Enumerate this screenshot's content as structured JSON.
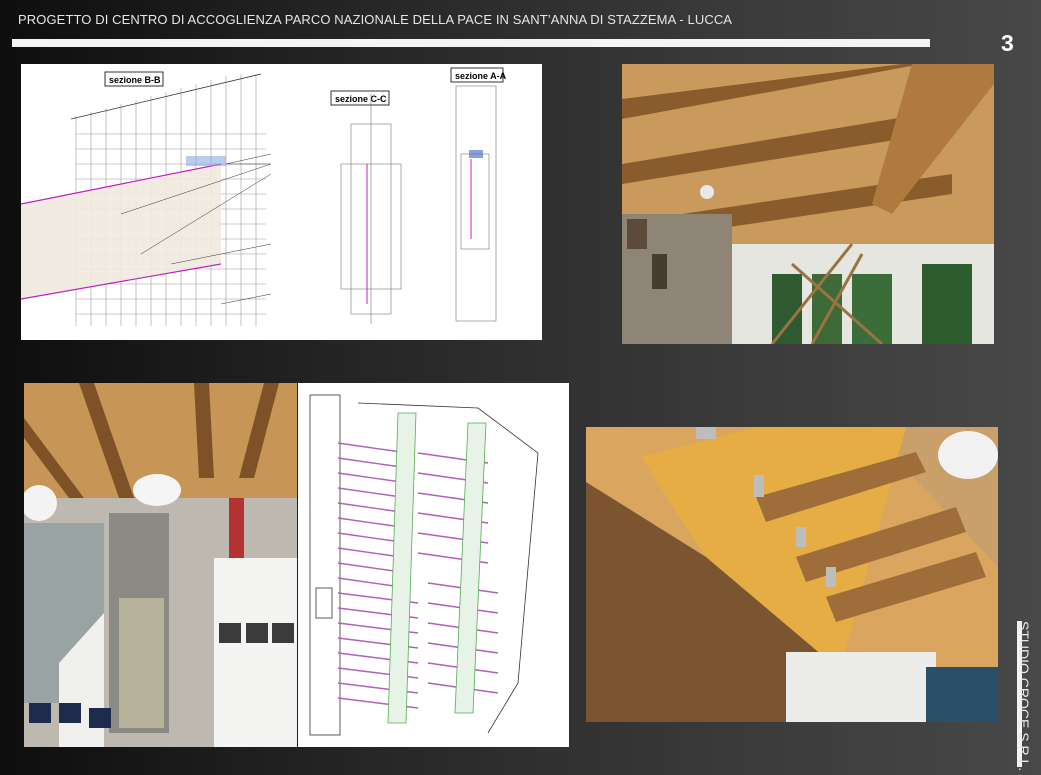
{
  "header": {
    "title": "PROGETTO DI CENTRO DI ACCOGLIENZA PARCO NAZIONALE DELLA PACE IN SANT’ANNA DI STAZZEMA - LUCCA",
    "page_number": "3"
  },
  "drawings": {
    "sections": {
      "section_bb_label": "sezione B-B",
      "section_cc_label": "sezione C-C",
      "section_aa_label": "sezione A-A"
    }
  },
  "footer": {
    "brand": "STUDIO CROCE S.R.L."
  }
}
